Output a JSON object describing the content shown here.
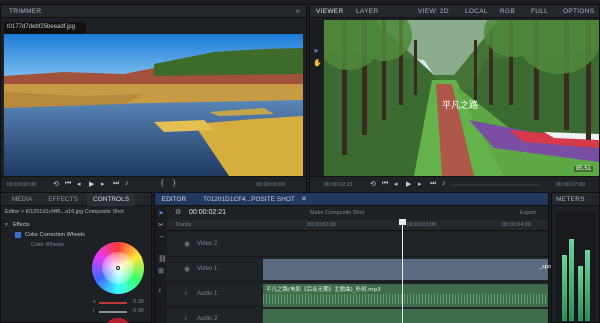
{
  "trimmer": {
    "header": "TRIMMER",
    "filename": "t0177d7debf25beeadf.jpg",
    "timecode_left": "00:00:00:00",
    "timecode_right": "00:00:00:00"
  },
  "viewer": {
    "tabs": [
      "VIEWER",
      "LAYER"
    ],
    "options": [
      "VIEW: 2D",
      "LOCAL",
      "RGB",
      "FULL",
      "OPTIONS"
    ],
    "timecode_left": "00:00:02:21",
    "timecode_right": "00:00:07:00",
    "overlay_text": "平凡之路",
    "zoom_value": "85.51"
  },
  "left_panel": {
    "tabs": [
      "MEDIA",
      "EFFECTS",
      "CONTROLS"
    ],
    "breadcrumb": "Editor > t01201d1cf4f6...a16.jpg Composite Shot",
    "effects_label": "Effects",
    "effect_name": "Color Correction Wheels",
    "sub_label": "Color Wheels",
    "value1": "0.00",
    "value2": "0.00"
  },
  "editor": {
    "tabs": [
      "EDITOR",
      "T01201D1CF4...POSITE SHOT"
    ],
    "timecode": "00:00:02:21",
    "make_composite": "Make Composite Shot",
    "export_label": "Export",
    "tracks_label": "Tracks",
    "ruler_marks": [
      "00:00:02:00",
      "00:00:03:00",
      "00:00:04:00"
    ],
    "tracks": [
      {
        "name": "Video 2"
      },
      {
        "name": "Video 1"
      },
      {
        "name": "Audio 1",
        "clip": "平凡之路(电影《后会无期》主题曲)_朴树.mp3"
      },
      {
        "name": "Audio 2"
      }
    ],
    "clip_small": "_sport"
  },
  "meters": {
    "header": "METERS",
    "levels": [
      0.6,
      0.75,
      0.5,
      0.65
    ]
  },
  "colors": {
    "accent": "#3d6fd1",
    "clip": "#5b6b82",
    "audio": "#3f6d4c"
  }
}
